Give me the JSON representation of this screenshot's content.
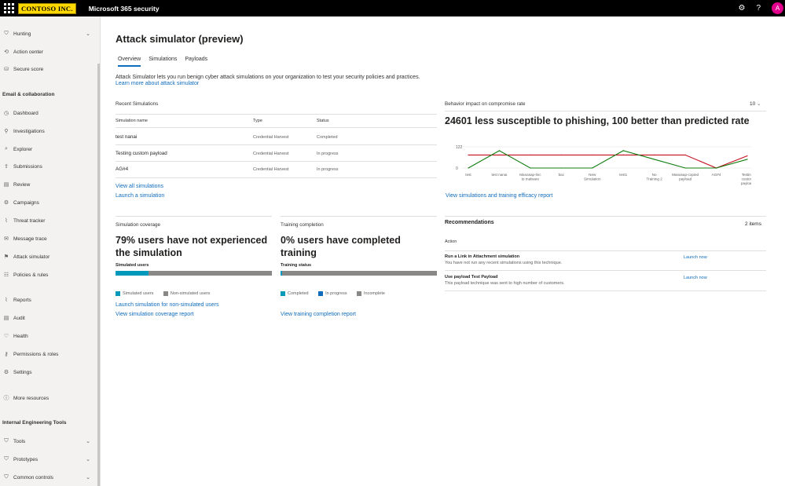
{
  "topbar": {
    "logo": "CONTOSO INC.",
    "app_title": "Microsoft 365 security",
    "avatar": "A",
    "settings_icon": "gear-icon",
    "help": "?"
  },
  "sidebar": {
    "items": [
      {
        "label": "Hunting",
        "icon": "⛉",
        "chevron": true
      },
      {
        "label": "Action center",
        "icon": "⟲"
      },
      {
        "label": "Secure score",
        "icon": "⛁"
      },
      {
        "label": "Dashboard",
        "icon": "◷"
      },
      {
        "label": "Investigations",
        "icon": "⚲"
      },
      {
        "label": "Explorer",
        "icon": "⌕"
      },
      {
        "label": "Submissions",
        "icon": "⇪"
      },
      {
        "label": "Review",
        "icon": "▤"
      },
      {
        "label": "Campaigns",
        "icon": "⚙"
      },
      {
        "label": "Threat tracker",
        "icon": "⌇"
      },
      {
        "label": "Message trace",
        "icon": "✉"
      },
      {
        "label": "Attack simulator",
        "icon": "⚑"
      },
      {
        "label": "Policies & rules",
        "icon": "☷"
      },
      {
        "label": "Reports",
        "icon": "⌇"
      },
      {
        "label": "Audit",
        "icon": "▤"
      },
      {
        "label": "Health",
        "icon": "♡"
      },
      {
        "label": "Permissions & roles",
        "icon": "⚷"
      },
      {
        "label": "Settings",
        "icon": "⚙"
      },
      {
        "label": "More resources",
        "icon": "ⓘ"
      },
      {
        "label": "Tools",
        "icon": "⛉",
        "chevron": true
      },
      {
        "label": "Prototypes",
        "icon": "⛉",
        "chevron": true
      },
      {
        "label": "Common controls",
        "icon": "⛉",
        "chevron": true
      }
    ],
    "section_email": "Email & collaboration",
    "section_tools": "Internal Engineering Tools",
    "chevron": "⌄"
  },
  "page": {
    "title": "Attack simulator (preview)",
    "tabs": [
      "Overview",
      "Simulations",
      "Payloads"
    ],
    "description": "Attack Simulator lets you run benign cyber attack simulations on your organization to test your security policies and practices.",
    "learn_more": "Learn more about attack simulator"
  },
  "recent": {
    "title": "Recent Simulations",
    "columns": [
      "Simulation name",
      "Type",
      "Status"
    ],
    "rows": [
      [
        "test nanai",
        "Credential Harvest",
        "Completed"
      ],
      [
        "Testing custom payload",
        "Credential Harvest",
        "In progress"
      ],
      [
        "AG#4",
        "Credential Harvest",
        "In progress"
      ]
    ],
    "view_all": "View all simulations",
    "launch": "Launch a simulation"
  },
  "behavior": {
    "title": "Behavior impact on compromise rate",
    "dropdown": "10",
    "headline": "24601 less susceptible to phishing, 100 better than predicted rate",
    "link": "View simulations and training efficacy report"
  },
  "chart_data": {
    "type": "line",
    "categories": [
      "test",
      "test nanai",
      "Manasap-linc to malware",
      "bac",
      "New Simulation",
      "test1",
      "No Training 2",
      "Manasap-copied payload",
      "AG#4",
      "Testing custom payload"
    ],
    "yticks": [
      "122",
      "0"
    ],
    "ylim": [
      0,
      122
    ],
    "series": [
      {
        "color": "#c50f1f",
        "values": [
          75,
          75,
          75,
          75,
          75,
          75,
          75,
          75,
          0,
          70
        ]
      },
      {
        "color": "#107c10",
        "values": [
          0,
          100,
          0,
          0,
          0,
          100,
          50,
          0,
          0,
          50
        ]
      }
    ]
  },
  "coverage": {
    "title": "Simulation coverage",
    "headline": "79% users have not experienced the simulation",
    "bar_label": "Simulated users",
    "fraction": 0.21,
    "legend": [
      "Simulated users",
      "Non-simulated users"
    ],
    "colors": [
      "#0099bc",
      "#8a8886"
    ],
    "link1": "Launch simulation for non-simulated users",
    "link2": "View simulation coverage report"
  },
  "training": {
    "title": "Training completion",
    "headline": "0% users have completed training",
    "bar_label": "Training status",
    "fraction": 0.01,
    "legend": [
      "Completed",
      "In progress",
      "Incomplete"
    ],
    "colors": [
      "#0099bc",
      "#0f6cbd",
      "#8a8886"
    ],
    "link": "View training completion report"
  },
  "recommendations": {
    "title": "Recommendations",
    "count": "2 items",
    "column": "Action",
    "items": [
      {
        "title": "Run a Link in Attachment simulation",
        "desc": "You have not run any recent simulations using this technique.",
        "action": "Launch now"
      },
      {
        "title": "Use payload Test Payload",
        "desc": "This payload technique was sent to high number of customers.",
        "action": "Launch now"
      }
    ]
  }
}
